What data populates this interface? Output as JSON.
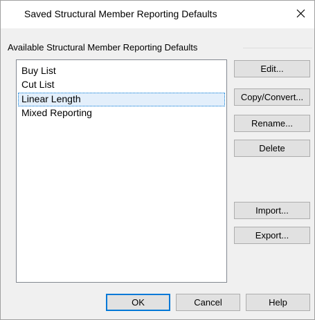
{
  "dialog": {
    "title": "Saved Structural Member Reporting Defaults",
    "close_glyph": "✕"
  },
  "group": {
    "label": "Available Structural Member Reporting Defaults"
  },
  "list": {
    "items": [
      {
        "label": "Buy List",
        "selected": false
      },
      {
        "label": "Cut List",
        "selected": false
      },
      {
        "label": "Linear Length",
        "selected": true
      },
      {
        "label": "Mixed Reporting",
        "selected": false
      }
    ]
  },
  "side_buttons": {
    "edit": "Edit...",
    "copy_convert": "Copy/Convert...",
    "rename": "Rename...",
    "delete": "Delete",
    "import": "Import...",
    "export": "Export..."
  },
  "bottom_buttons": {
    "ok": "OK",
    "cancel": "Cancel",
    "help": "Help"
  },
  "colors": {
    "selection_bg": "#e3effb",
    "focus_outline": "#0078d7",
    "dialog_bg": "#f0f0f0",
    "button_bg": "#e1e1e1"
  },
  "icons": {
    "close": "close-icon"
  }
}
